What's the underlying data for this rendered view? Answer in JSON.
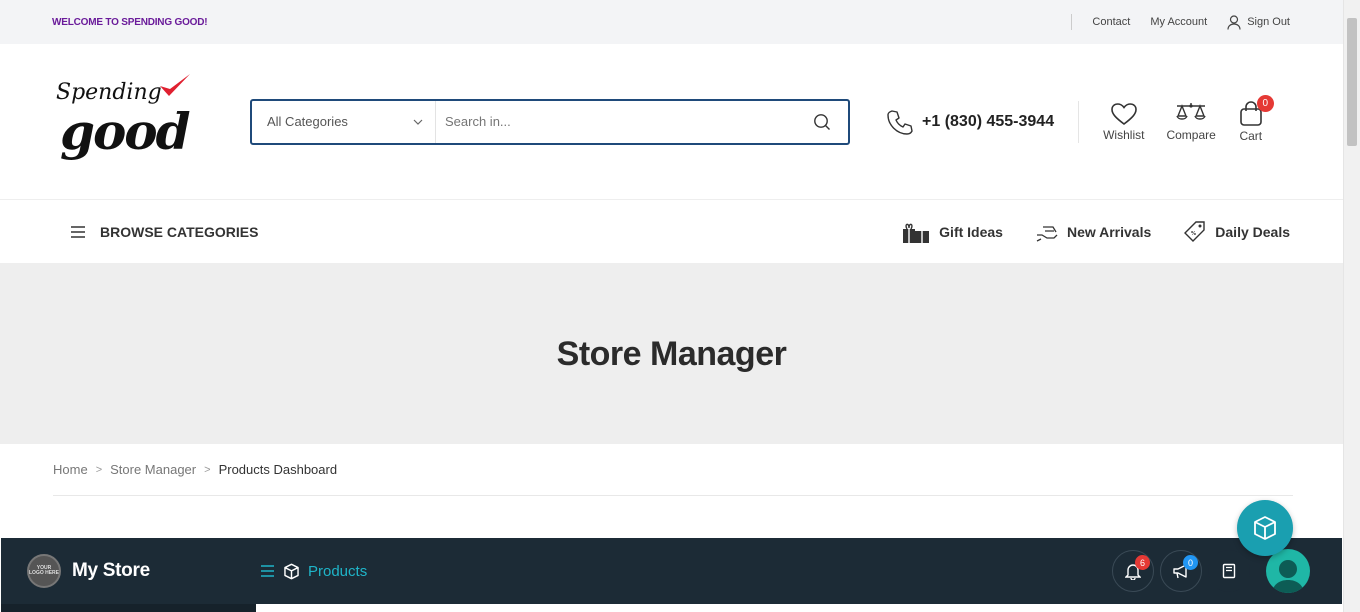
{
  "topbar": {
    "welcome": "WELCOME TO SPENDING GOOD!",
    "links": [
      "Contact",
      "My Account"
    ],
    "signout": "Sign Out"
  },
  "logo": {
    "line1": "Spending",
    "line2": "good"
  },
  "search": {
    "category": "All Categories",
    "placeholder": "Search in..."
  },
  "phone": "+1 (830) 455-3944",
  "header_icons": {
    "wishlist": "Wishlist",
    "compare": "Compare",
    "cart": "Cart",
    "cart_count": "0"
  },
  "nav": {
    "browse": "BROWSE CATEGORIES",
    "links": [
      "Gift Ideas",
      "New Arrivals",
      "Daily Deals"
    ]
  },
  "hero": {
    "title": "Store Manager"
  },
  "breadcrumb": [
    "Home",
    "Store Manager",
    "Products Dashboard"
  ],
  "dashbar": {
    "store_logo": "YOUR LOGO HERE",
    "store_name": "My Store",
    "section": "Products",
    "notifications_count": "6",
    "announcements_count": "0"
  },
  "colors": {
    "welcome": "#6a1b9a",
    "search_border": "#1f4a7a",
    "badge": "#e53935",
    "dashbar": "#1c2b36",
    "accent": "#1fb5c9",
    "fab": "#1a9fb0"
  }
}
